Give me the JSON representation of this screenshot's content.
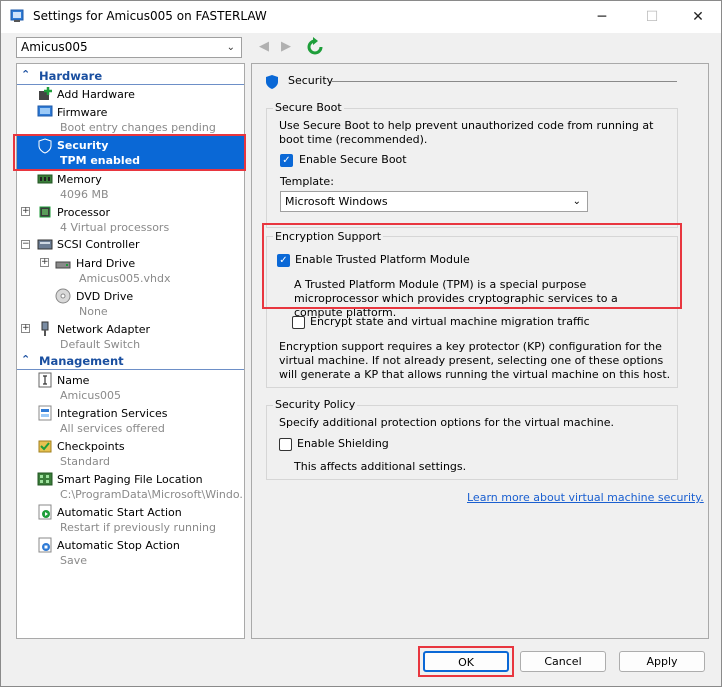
{
  "window": {
    "title": "Settings for Amicus005 on FASTERLAW",
    "minimize": "─",
    "maximize": "☐",
    "close": "✕"
  },
  "toolbar": {
    "vm_selected": "Amicus005",
    "back": "◀",
    "forward": "▶"
  },
  "tree": {
    "hardware_header": "Hardware",
    "management_header": "Management",
    "add_hardware": "Add Hardware",
    "firmware": {
      "name": "Firmware",
      "sub": "Boot entry changes pending"
    },
    "security": {
      "name": "Security",
      "sub": "TPM enabled"
    },
    "memory": {
      "name": "Memory",
      "sub": "4096 MB"
    },
    "processor": {
      "name": "Processor",
      "sub": "4 Virtual processors"
    },
    "scsi": {
      "name": "SCSI Controller"
    },
    "hard_drive": {
      "name": "Hard Drive",
      "sub": "Amicus005.vhdx"
    },
    "dvd_drive": {
      "name": "DVD Drive",
      "sub": "None"
    },
    "network": {
      "name": "Network Adapter",
      "sub": "Default Switch"
    },
    "name": {
      "name": "Name",
      "sub": "Amicus005"
    },
    "integration": {
      "name": "Integration Services",
      "sub": "All services offered"
    },
    "checkpoints": {
      "name": "Checkpoints",
      "sub": "Standard"
    },
    "paging": {
      "name": "Smart Paging File Location",
      "sub": "C:\\ProgramData\\Microsoft\\Windo..."
    },
    "autostart": {
      "name": "Automatic Start Action",
      "sub": "Restart if previously running"
    },
    "autostop": {
      "name": "Automatic Stop Action",
      "sub": "Save"
    }
  },
  "panel": {
    "heading": "Security",
    "secure_boot": {
      "title": "Secure Boot",
      "desc": "Use Secure Boot to help prevent unauthorized code from running at boot time (recommended).",
      "enable_label": "Enable Secure Boot",
      "enabled": true,
      "template_label": "Template:",
      "template_value": "Microsoft Windows"
    },
    "encryption": {
      "title": "Encryption Support",
      "tpm_label": "Enable Trusted Platform Module",
      "tpm_enabled": true,
      "tpm_desc": "A Trusted Platform Module (TPM) is a special purpose microprocessor which provides cryptographic services to a compute platform.",
      "encrypt_label": "Encrypt state and virtual machine migration traffic",
      "encrypt_enabled": false,
      "kp_desc": "Encryption support requires a key protector (KP) configuration for the virtual machine. If not already present, selecting one of these options will generate a KP that allows running the virtual machine on this host."
    },
    "policy": {
      "title": "Security Policy",
      "desc": "Specify additional protection options for the virtual machine.",
      "shielding_label": "Enable Shielding",
      "shielding_enabled": false,
      "note": "This affects additional settings."
    },
    "learn_more": "Learn more about virtual machine security."
  },
  "buttons": {
    "ok": "OK",
    "cancel": "Cancel",
    "apply": "Apply"
  },
  "colors": {
    "accent": "#0a68d6",
    "highlight_box": "#e8363f",
    "section_text": "#1a4fa0"
  }
}
